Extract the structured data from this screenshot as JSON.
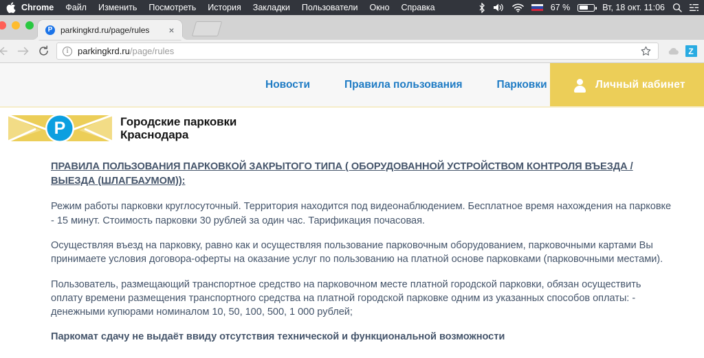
{
  "menubar": {
    "apple_icon": "apple-logo",
    "app_name": "Chrome",
    "items": [
      "Файл",
      "Изменить",
      "Посмотреть",
      "История",
      "Закладки",
      "Пользователи",
      "Окно",
      "Справка"
    ],
    "status_icons": [
      "bluetooth-icon",
      "volume-icon",
      "wifi-icon",
      "flag-ru-icon"
    ],
    "battery_percent": "67 %",
    "clock": "Вт, 18 окт.  11:06",
    "right_icons": [
      "search-icon",
      "control-center-icon"
    ]
  },
  "browser": {
    "tab": {
      "favicon_letter": "P",
      "title": "parkingkrd.ru/page/rules",
      "close_label": "×"
    },
    "toolbar": {
      "back_icon": "arrow-left-icon",
      "forward_icon": "arrow-right-icon",
      "reload_icon": "reload-icon",
      "security_icon": "info-icon",
      "url_host": "parkingkrd.ru",
      "url_path": "/page/rules",
      "bookmark_icon": "star-icon",
      "extension_cloud_icon": "cloud-icon",
      "extension_z_label": "Z"
    }
  },
  "site": {
    "nav": [
      {
        "label": "Новости"
      },
      {
        "label": "Правила пользования"
      },
      {
        "label": "Парковки"
      }
    ],
    "account": {
      "icon": "person-icon",
      "label": "Личный кабинет"
    },
    "logo": {
      "letter": "Р",
      "title_line1": "Городские парковки",
      "title_line2": "Краснодара"
    }
  },
  "document": {
    "heading": "ПРАВИЛА ПОЛЬЗОВАНИЯ ПАРКОВКОЙ ЗАКРЫТОГО ТИПА ( ОБОРУДОВАННОЙ УСТРОЙСТВОМ КОНТРОЛЯ ВЪЕЗДА / ВЫЕЗДА (ШЛАГБАУМОМ)):",
    "para1": "Режим работы парковки круглосуточный. Территория находится под видеонаблюдением. Бесплатное время нахождения на парковке - 15 минут. Стоимость парковки 30 рублей за один час. Тарификация почасовая.",
    "para2": "Осуществляя въезд на парковку, равно как и осуществляя пользование парковочным оборудованием, парковочными картами  Вы принимаете условия договора-оферты на оказание услуг по пользованию на платной основе парковками (парковочными местами).",
    "para3": "Пользователь, размещающий транспортное средство на парковочном месте платной городской парковки, обязан осуществить оплату времени размещения транспортного средства на платной городской парковке одним из указанных способов оплаты: - денежными купюрами номиналом 10, 50, 100, 500, 1 000 рублей;",
    "para4": "Паркомат сдачу не выдаёт ввиду отсутствия технической и функциональной возможности"
  },
  "colors": {
    "menubar_bg": "#32353c",
    "nav_link": "#1e7bc4",
    "accent_yellow": "#ecce58",
    "logo_blue": "#0c9fe0",
    "doc_text": "#44546a"
  }
}
